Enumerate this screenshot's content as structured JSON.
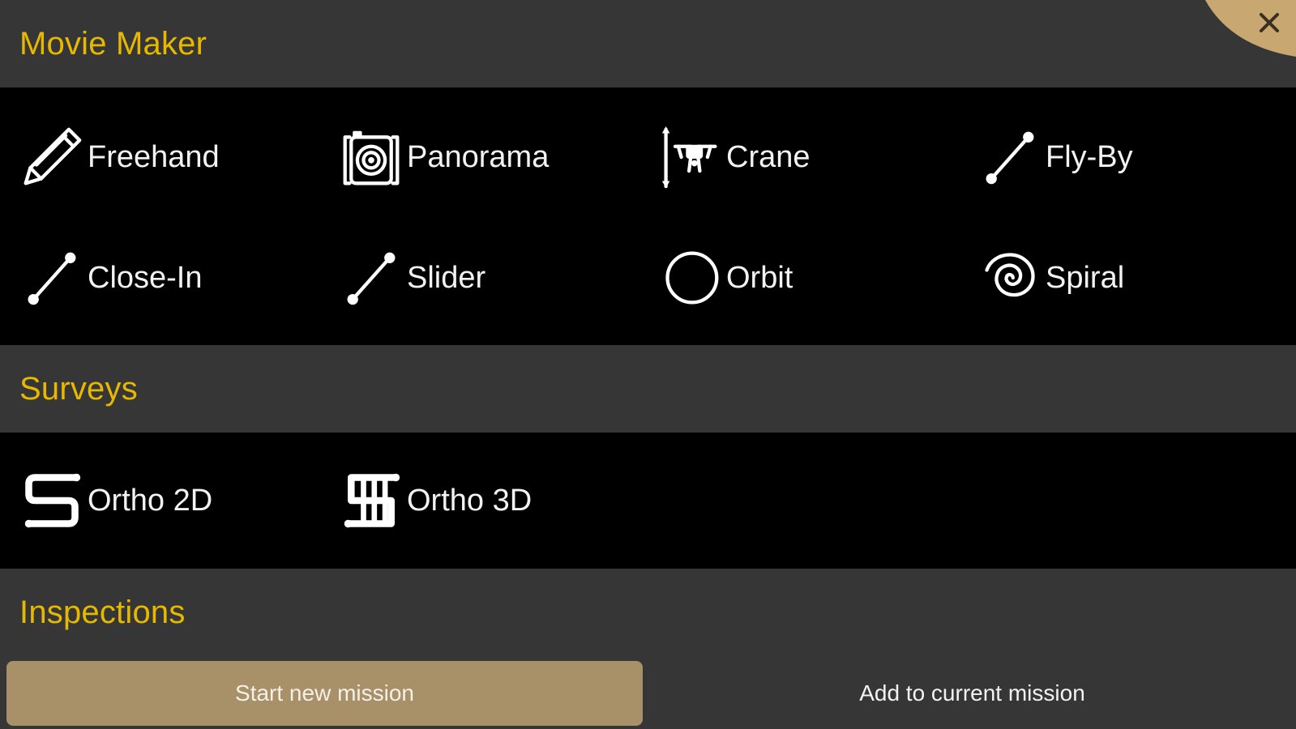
{
  "sections": {
    "movie_maker": {
      "title": "Movie Maker",
      "items": [
        {
          "label": "Freehand",
          "icon": "pencil-icon"
        },
        {
          "label": "Panorama",
          "icon": "panorama-camera-icon"
        },
        {
          "label": "Crane",
          "icon": "crane-drone-icon"
        },
        {
          "label": "Fly-By",
          "icon": "line-segment-icon"
        },
        {
          "label": "Close-In",
          "icon": "line-segment-icon"
        },
        {
          "label": "Slider",
          "icon": "line-segment-icon"
        },
        {
          "label": "Orbit",
          "icon": "circle-icon"
        },
        {
          "label": "Spiral",
          "icon": "spiral-icon"
        }
      ]
    },
    "surveys": {
      "title": "Surveys",
      "items": [
        {
          "label": "Ortho 2D",
          "icon": "ortho-2d-path-icon"
        },
        {
          "label": "Ortho 3D",
          "icon": "ortho-3d-grid-icon"
        }
      ]
    },
    "inspections": {
      "title": "Inspections"
    }
  },
  "footer": {
    "start_label": "Start new mission",
    "add_label": "Add to current mission"
  },
  "close": {
    "icon": "close-icon"
  },
  "colors": {
    "accent": "#e6b800",
    "header_bg": "#363636",
    "body_bg": "#000000",
    "button_primary": "#a89068",
    "close_tab": "#c8a870"
  }
}
